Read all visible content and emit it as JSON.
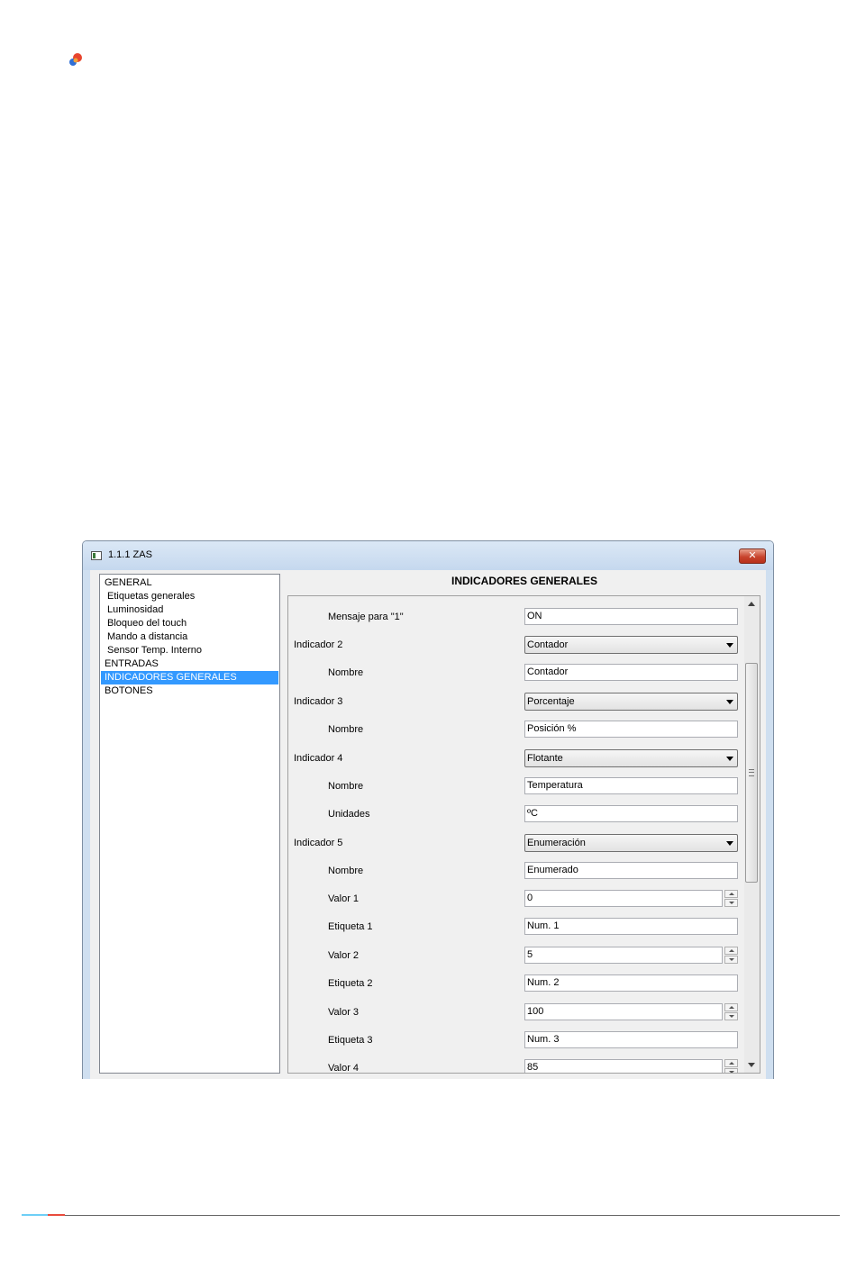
{
  "window": {
    "title": "1.1.1 ZAS",
    "close_glyph": "✕"
  },
  "tree": {
    "items": [
      {
        "label": "GENERAL"
      },
      {
        "label": "Etiquetas generales"
      },
      {
        "label": "Luminosidad"
      },
      {
        "label": "Bloqueo del touch"
      },
      {
        "label": "Mando a distancia"
      },
      {
        "label": "Sensor Temp. Interno"
      },
      {
        "label": "ENTRADAS"
      },
      {
        "label": "INDICADORES GENERALES"
      },
      {
        "label": "BOTONES"
      }
    ],
    "selected": "INDICADORES GENERALES"
  },
  "panel": {
    "title": "INDICADORES GENERALES",
    "rows": [
      {
        "label": "Mensaje para \"1\"",
        "value": "ON"
      },
      {
        "label": "Indicador 2",
        "value": "Contador"
      },
      {
        "label": "Nombre",
        "value": "Contador"
      },
      {
        "label": "Indicador 3",
        "value": "Porcentaje"
      },
      {
        "label": "Nombre",
        "value": "Posición %"
      },
      {
        "label": "Indicador 4",
        "value": "Flotante"
      },
      {
        "label": "Nombre",
        "value": "Temperatura"
      },
      {
        "label": "Unidades",
        "value": "ºC"
      },
      {
        "label": "Indicador 5",
        "value": "Enumeración"
      },
      {
        "label": "Nombre",
        "value": "Enumerado"
      },
      {
        "label": "Valor 1",
        "value": "0"
      },
      {
        "label": "Etiqueta 1",
        "value": "Num. 1"
      },
      {
        "label": "Valor 2",
        "value": "5"
      },
      {
        "label": "Etiqueta 2",
        "value": "Num. 2"
      },
      {
        "label": "Valor 3",
        "value": "100"
      },
      {
        "label": "Etiqueta 3",
        "value": "Num. 3"
      },
      {
        "label": "Valor 4",
        "value": "85"
      }
    ]
  },
  "colors": {
    "selection": "#3399ff",
    "title_bar": "#cfdff0",
    "close_button": "#c8452e"
  }
}
